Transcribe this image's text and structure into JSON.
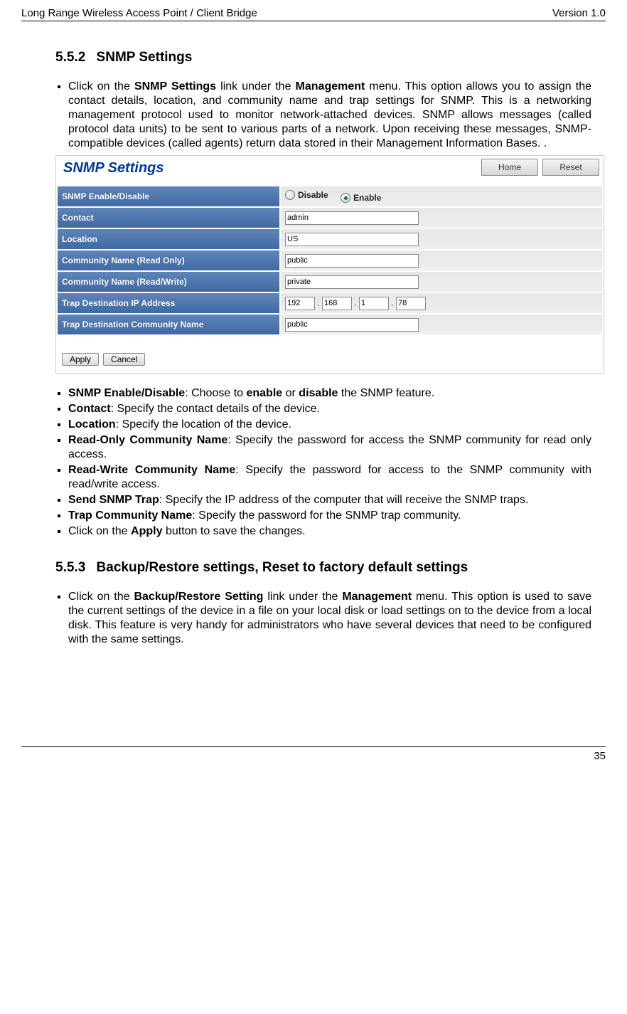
{
  "header": {
    "left": "Long Range Wireless Access Point / Client Bridge",
    "right": "Version 1.0"
  },
  "footer": {
    "pagenum": "35"
  },
  "sec1": {
    "num": "5.5.2",
    "title": "SNMP Settings",
    "intro_pre": "Click on the ",
    "intro_link": "SNMP Settings",
    "intro_mid": " link under the ",
    "intro_menu": "Management",
    "intro_post": " menu. This option allows you to assign the contact details, location, and community name and trap settings for SNMP. This is a networking management protocol used to monitor network-attached devices. SNMP allows messages (called protocol data units) to be sent to various parts of a network. Upon receiving these messages, SNMP-compatible devices (called agents) return data stored in their Management Information Bases. ."
  },
  "snmp": {
    "title": "SNMP Settings",
    "btn_home": "Home",
    "btn_reset": "Reset",
    "rows": {
      "enable": "SNMP Enable/Disable",
      "disable_lbl": "Disable",
      "enable_lbl": "Enable",
      "contact": "Contact",
      "contact_v": "admin",
      "location": "Location",
      "location_v": "US",
      "comm_ro": "Community Name (Read Only)",
      "comm_ro_v": "public",
      "comm_rw": "Community Name (Read/Write)",
      "comm_rw_v": "private",
      "trap_ip": "Trap Destination IP Address",
      "ip1": "192",
      "ip2": "168",
      "ip3": "1",
      "ip4": "78",
      "trap_comm": "Trap Destination Community Name",
      "trap_comm_v": "public"
    },
    "apply": "Apply",
    "cancel": "Cancel"
  },
  "defs": {
    "d1b": "SNMP Enable/Disable",
    "d1m": ": Choose to ",
    "d1b2": "enable",
    "d1m2": " or ",
    "d1b3": "disable",
    "d1e": " the SNMP feature.",
    "d2b": "Contact",
    "d2e": ": Specify the contact details of the device.",
    "d3b": "Location",
    "d3e": ": Specify the location of the device.",
    "d4b": "Read-Only Community Name",
    "d4e": ": Specify the password for access the SNMP community for read only access.",
    "d5b": "Read-Write Community Name",
    "d5e": ": Specify the password for access to the SNMP community with read/write access.",
    "d6b": "Send SNMP Trap",
    "d6e": ": Specify the IP address of the computer that will receive the SNMP traps.",
    "d7b": "Trap Community Name",
    "d7e": ": Specify the password for the SNMP trap community.",
    "d8p": "Click on the ",
    "d8b": "Apply",
    "d8e": " button to save the changes."
  },
  "sec2": {
    "num": "5.5.3",
    "title": "Backup/Restore settings, Reset to factory default settings",
    "intro_pre": "Click on the ",
    "intro_link": "Backup/Restore Setting",
    "intro_mid": " link under the ",
    "intro_menu": "Management",
    "intro_post": " menu. This option is used to save the current settings of the device in a file on your local disk or load settings on to the device from a local disk. This feature is very handy for administrators who have several devices that need to be configured with the same settings."
  }
}
